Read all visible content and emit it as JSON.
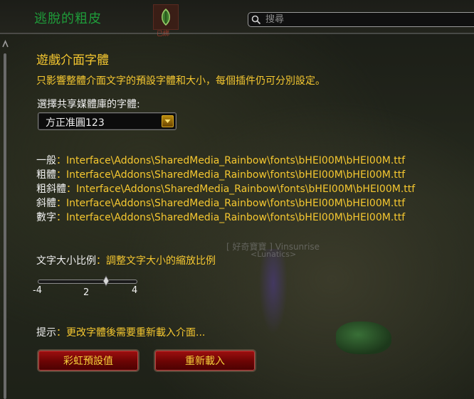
{
  "header": {
    "addon_title": "逃脫的粗皮",
    "category_label": "已綁",
    "search_placeholder": "搜尋"
  },
  "section": {
    "title": "遊戲介面字體",
    "description": "只影響整體介面文字的預設字體和大小，每個插件仍可分別設定。"
  },
  "font_select": {
    "label": "選擇共享媒體庫的字體:",
    "value": "方正准圓123"
  },
  "font_paths": [
    {
      "key": "一般",
      "sep": "：",
      "value": "Interface\\Addons\\SharedMedia_Rainbow\\fonts\\bHEI00M\\bHEI00M.ttf"
    },
    {
      "key": "粗體",
      "sep": "：",
      "value": "Interface\\Addons\\SharedMedia_Rainbow\\fonts\\bHEI00M\\bHEI00M.ttf"
    },
    {
      "key": "粗斜體",
      "sep": "：",
      "value": "Interface\\Addons\\SharedMedia_Rainbow\\fonts\\bHEI00M\\bHEI00M.ttf"
    },
    {
      "key": "斜體",
      "sep": "：",
      "value": "Interface\\Addons\\SharedMedia_Rainbow\\fonts\\bHEI00M\\bHEI00M.ttf"
    },
    {
      "key": "數字",
      "sep": "：",
      "value": "Interface\\Addons\\SharedMedia_Rainbow\\fonts\\bHEI00M\\bHEI00M.ttf"
    }
  ],
  "size_scale": {
    "label": "文字大小比例",
    "sep": "：",
    "description": "調整文字大小的縮放比例",
    "min": "-4",
    "value": "2",
    "max": "4"
  },
  "hint": {
    "label": "提示",
    "sep": "：",
    "text": "更改字體後需要重新載入介面..."
  },
  "buttons": {
    "rainbow_default": "彩虹預設值",
    "reload": "重新載入"
  },
  "background": {
    "nameplate": "[ 好奇寶寶 ] Vinsunrise",
    "guild": "<Lunatics>"
  },
  "colors": {
    "accent_gold": "#f6c830",
    "title_green": "#1f9c3a",
    "button_red": "#8a0808"
  }
}
